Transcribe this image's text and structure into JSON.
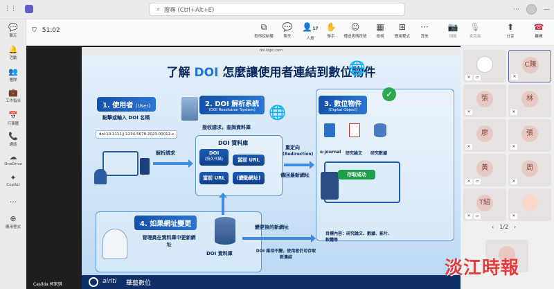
{
  "topbar": {
    "search_placeholder": "搜尋 (Ctrl+Alt+E)"
  },
  "rail": [
    {
      "label": "聊天",
      "icon": "chat-icon"
    },
    {
      "label": "活動",
      "icon": "bell-icon"
    },
    {
      "label": "團隊",
      "icon": "teams-icon"
    },
    {
      "label": "工作指派",
      "icon": "briefcase-icon"
    },
    {
      "label": "行事曆",
      "icon": "calendar-icon"
    },
    {
      "label": "通話",
      "icon": "phone-icon"
    },
    {
      "label": "OneDrive",
      "icon": "cloud-icon"
    },
    {
      "label": "Copilot",
      "icon": "copilot-icon"
    },
    {
      "label": "...",
      "icon": "more-icon"
    },
    {
      "label": "應用程式",
      "icon": "apps-icon"
    }
  ],
  "meeting": {
    "timer": "51:02",
    "tools": [
      {
        "label": "取得控制權",
        "icon": "control-icon"
      },
      {
        "label": "聊天",
        "icon": "chat-icon"
      },
      {
        "label": "人員",
        "icon": "people-icon",
        "count": "17"
      },
      {
        "label": "舉手",
        "icon": "hand-icon"
      },
      {
        "label": "傳送表情符號",
        "icon": "emoji-icon"
      },
      {
        "label": "檢視",
        "icon": "view-icon"
      },
      {
        "label": "應用程式",
        "icon": "add-app-icon"
      },
      {
        "label": "其他",
        "icon": "more-icon"
      },
      {
        "label": "相機",
        "icon": "camera-off-icon"
      },
      {
        "label": "麥克風",
        "icon": "mic-off-icon"
      },
      {
        "label": "分享",
        "icon": "share-icon"
      },
      {
        "label": "離開",
        "icon": "leave-icon"
      }
    ]
  },
  "slide": {
    "url": "doi.logic.com",
    "title_pre": "了解 ",
    "title_hl": "DOI",
    "title_post": " 怎麼讓使用者連結到數位物件",
    "s1_title": "1. 使用者",
    "s1_en": "(User)",
    "s1_desc": "點擊或輸入 DOI 名稱",
    "doi_value": "doi:10.1111/j.1234-5678.2023.00012.x",
    "parse_request": "解析請求",
    "s2_title": "2. DOI 解析系統",
    "s2_en": "(DOI Resolution System)",
    "s2_desc": "接收請求，查詢資料庫",
    "db_title": "DOI 資料庫",
    "db_doi": "DOI",
    "db_doi_sub": "(持久代碼)",
    "db_current_url": "當前 URL",
    "db_current_url2": "當前 URL",
    "db_changed": "(變動網址)",
    "redirect": "重定向",
    "redirect_en": "(Redirection)",
    "return_url": "傳回最新網址",
    "s3_title": "3. 數位物件",
    "s3_en": "(Digital Object)",
    "obj1": "e-journal",
    "obj2": "研究論文",
    "obj3": "研究數據",
    "access_ok": "存取成功",
    "target_content": "目標內容：研究論文、數據、影片、軟體等",
    "s4_title": "4. 如果網址變更",
    "s4_desc": "管理員在資料庫中更新網址",
    "s4_db": "DOI 資料庫",
    "new_url": "變更後的新網址",
    "keep_note": "DOI 維持不變，使用者仍可存取新連結",
    "footer_brand": "airiti",
    "footer_cn": "華藝數位"
  },
  "speaker_name": "Casilda 柯宋琪",
  "participants": [
    {
      "initial": "",
      "active": false
    },
    {
      "initial": "C陳",
      "active": true
    },
    {
      "initial": "張",
      "active": false
    },
    {
      "initial": "林",
      "active": false
    },
    {
      "initial": "廖",
      "active": false
    },
    {
      "initial": "張",
      "active": false
    },
    {
      "initial": "黃",
      "active": false
    },
    {
      "initial": "周",
      "active": false
    },
    {
      "initial": "T紹",
      "active": false
    },
    {
      "initial": "",
      "active": false
    }
  ],
  "pager": "1/2",
  "watermark": "淡江時報"
}
